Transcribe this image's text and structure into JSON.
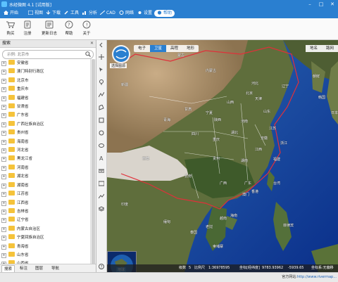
{
  "app": {
    "title": "水经微图 4.1 [试用版]"
  },
  "menu": [
    {
      "label": "开始",
      "icon": "home-icon"
    },
    {
      "label": "视图",
      "icon": "view-icon"
    },
    {
      "label": "下载",
      "icon": "download-icon"
    },
    {
      "label": "工具",
      "icon": "tools-icon"
    },
    {
      "label": "分析",
      "icon": "analysis-icon"
    },
    {
      "label": "CAD",
      "icon": "cad-icon"
    },
    {
      "label": "网络",
      "icon": "network-icon"
    },
    {
      "label": "设置",
      "icon": "settings-icon"
    },
    {
      "label": "帮助",
      "icon": "help-icon"
    }
  ],
  "toolbar": [
    {
      "label": "购买",
      "icon": "cart-icon"
    },
    {
      "label": "注册",
      "icon": "register-icon"
    },
    {
      "label": "更新日志",
      "icon": "update-log-icon"
    },
    {
      "label": "帮助",
      "icon": "help-icon"
    },
    {
      "label": "关于",
      "icon": "info-icon"
    }
  ],
  "panel": {
    "title": "搜索",
    "search_placeholder": "示例: 北京市",
    "regions": [
      "安徽省",
      "澳门特别行政区",
      "北京市",
      "重庆市",
      "福建省",
      "甘肃省",
      "广东省",
      "广西壮族自治区",
      "贵州省",
      "海南省",
      "河北省",
      "黑龙江省",
      "河南省",
      "湖北省",
      "湖南省",
      "江苏省",
      "江西省",
      "吉林省",
      "辽宁省",
      "内蒙古自治区",
      "宁夏回族自治区",
      "青海省",
      "山东省",
      "山西省"
    ],
    "tabs": [
      "搜索",
      "标注",
      "图层",
      "导航"
    ]
  },
  "map": {
    "types": [
      "电子",
      "卫星",
      "高程",
      "地形"
    ],
    "active_type": "卫星",
    "right_types": [
      "地名",
      "路网"
    ],
    "compass_label": "选择图源",
    "minimap_label": "地球",
    "labels": [
      "辽宁",
      "河北",
      "北京",
      "天津",
      "山西",
      "山东",
      "河南",
      "江苏",
      "安徽",
      "浙江",
      "湖北",
      "江西",
      "福建",
      "湖南",
      "四川",
      "重庆",
      "贵州",
      "云南",
      "广西",
      "广东",
      "台湾",
      "香港",
      "澳门",
      "海南",
      "陕西",
      "甘肃",
      "宁夏",
      "青海",
      "西藏",
      "新疆",
      "内蒙古",
      "蒙古",
      "朝鲜",
      "韩国",
      "日本",
      "越南",
      "老挝",
      "泰国",
      "缅甸",
      "柬埔寨",
      "菲律宾",
      "印度"
    ]
  },
  "status": {
    "label": "级数",
    "level": "5",
    "scale_label": "比例尺",
    "scale": "1:36978595",
    "coord_label": "坐标[经纬度]",
    "x": "9783.93962",
    "y": "-5939.65",
    "coord_sys": "坐标系:无偏移"
  },
  "footer": {
    "site_label": "官方网站:",
    "site": "http://www.rivermap..."
  },
  "colors": {
    "accent": "#2a7fd0",
    "folder": "#f5c33b"
  }
}
